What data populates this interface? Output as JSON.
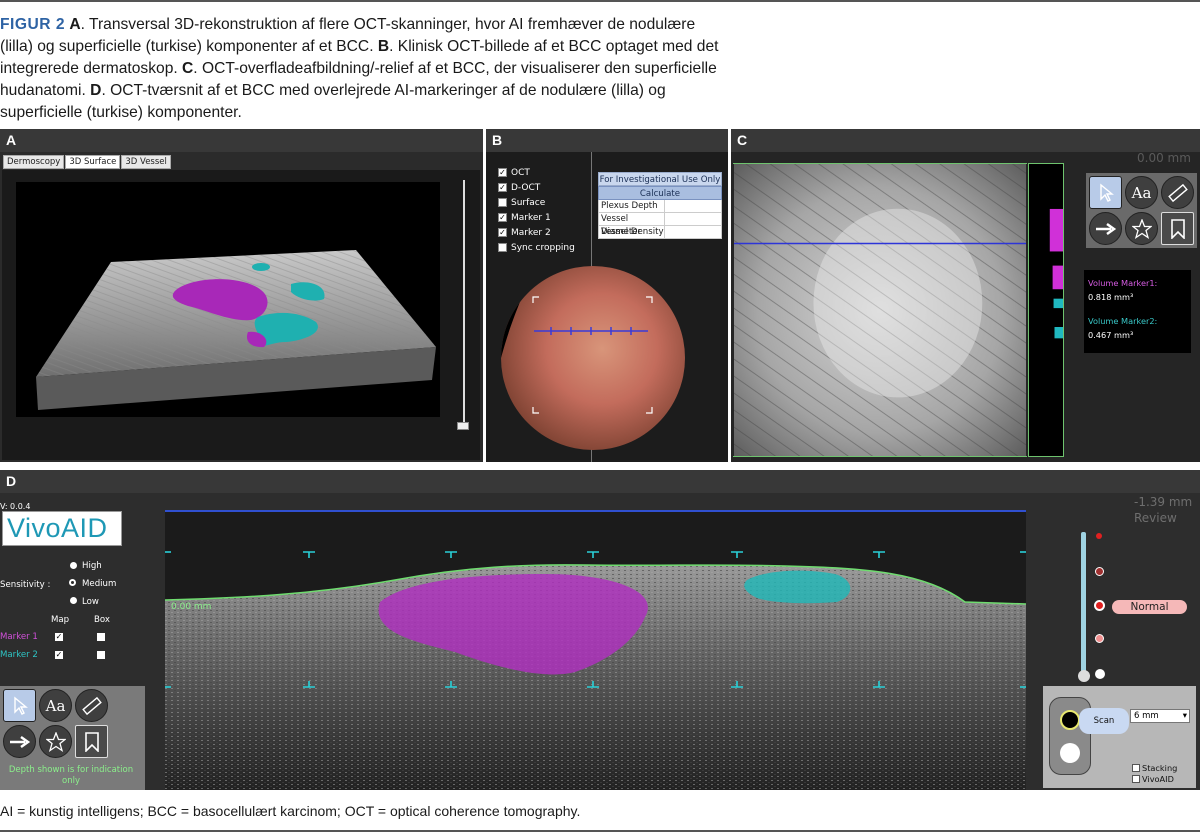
{
  "caption": {
    "figure_label": "FIGUR 2",
    "parts": [
      {
        "label": "A",
        "text": ". Transversal 3D-rekonstruktion af flere OCT-skanninger, hvor AI fremhæver de nodulære (lilla) og superficielle (turkise) komponenter af et BCC. "
      },
      {
        "label": "B",
        "text": ". Klinisk OCT-billede af et BCC optaget med det integrerede dermatoskop. "
      },
      {
        "label": "C",
        "text": ". OCT-overfladeafbildning/-relief af et BCC, der visualiserer den superficielle hudanatomi. "
      },
      {
        "label": "D",
        "text": ". OCT-tværsnit af et BCC med overlejrede AI-markeringer af de nodulære (lilla) og superficielle (turkise) komponenter."
      }
    ]
  },
  "footnote": "AI = kunstig intelligens; BCC = basocellulært karcinom; OCT = optical coherence tomography.",
  "panel_a": {
    "label": "A",
    "tabs": [
      "Dermoscopy",
      "3D Surface",
      "3D Vessel"
    ],
    "active_tab": 1
  },
  "panel_b": {
    "label": "B",
    "checkboxes": [
      {
        "label": "OCT",
        "checked": true
      },
      {
        "label": "D-OCT",
        "checked": true
      },
      {
        "label": "Surface",
        "checked": false
      },
      {
        "label": "Marker 1",
        "checked": true
      },
      {
        "label": "Marker 2",
        "checked": true
      },
      {
        "label": "Sync cropping",
        "checked": false
      }
    ],
    "table_header": "For Investigational Use Only",
    "calculate_label": "Calculate",
    "rows": [
      "Plexus Depth",
      "Vessel Diameter",
      "Vessel Density"
    ]
  },
  "panel_c": {
    "label": "C",
    "depth": "0.00 mm",
    "volume_marker1_label": "Volume Marker1:",
    "volume_marker1_value": "0.818 mm³",
    "volume_marker2_label": "Volume Marker2:",
    "volume_marker2_value": "0.467 mm³",
    "tools": [
      "pointer-icon",
      "text-tool-icon",
      "ruler-icon",
      "arrow-icon",
      "star-icon",
      "bookmark-icon"
    ],
    "text_tool_label": "Aa"
  },
  "panel_d": {
    "label": "D",
    "version": "V:  0.0.4",
    "logo": "VivoAID",
    "sensitivity_label": "Sensitivity :",
    "sensitivity_options": [
      "High",
      "Medium",
      "Low"
    ],
    "sensitivity_selected": "Medium",
    "map_label": "Map",
    "box_label": "Box",
    "markers": [
      {
        "label": "Marker 1",
        "color": "#d050d8",
        "map": true,
        "box": false
      },
      {
        "label": "Marker 2",
        "color": "#2ec4c4",
        "map": true,
        "box": false
      }
    ],
    "depth_note": "Depth shown is for indication only",
    "oct_depth_label": "0.00 mm",
    "depth": "-1.39 mm",
    "mode": "Review",
    "intensity_label": "Normal",
    "scan_label": "Scan",
    "scan_length": "6 mm",
    "stacking_label": "Stacking",
    "vivoaid_label": "VivoAID",
    "text_tool_label": "Aa"
  },
  "colors": {
    "nodular": "#b030c0",
    "superficial": "#22b8b8",
    "figure_label": "#2e63a4"
  }
}
